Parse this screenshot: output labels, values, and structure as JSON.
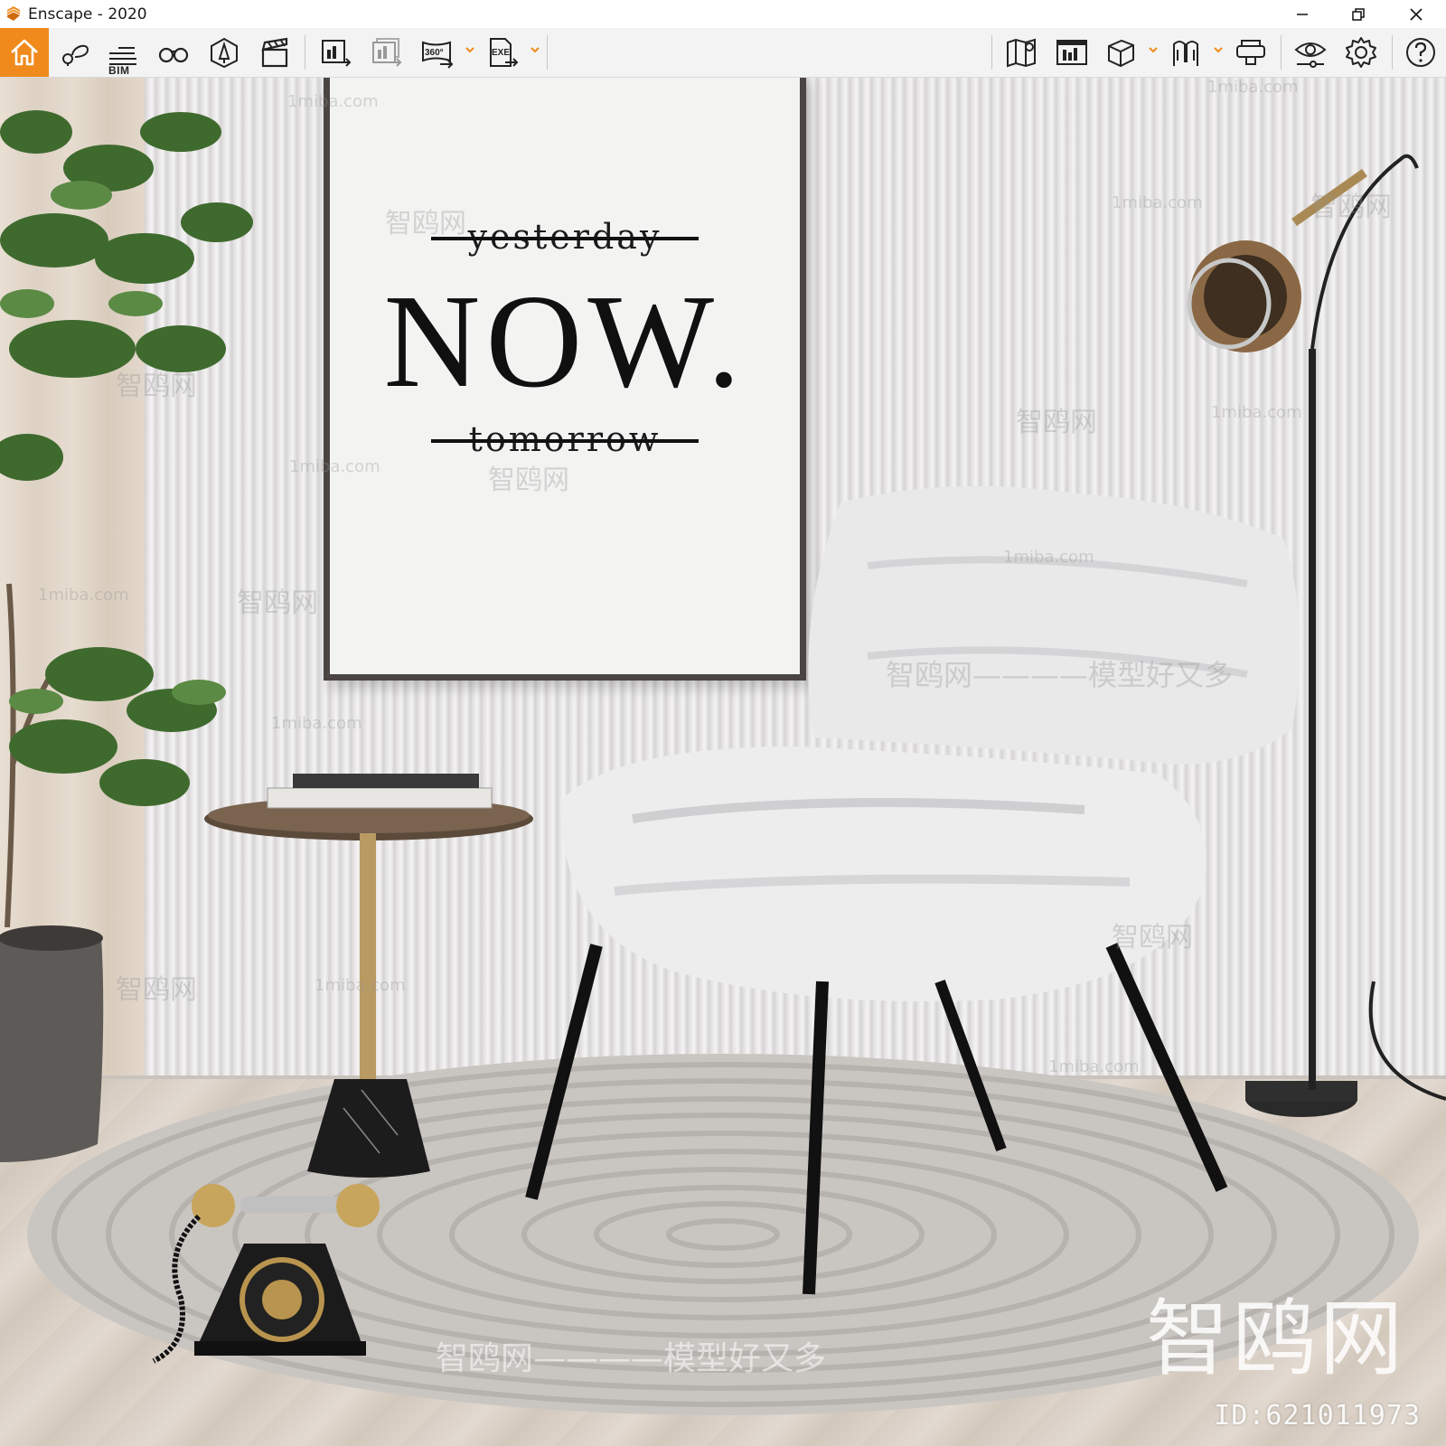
{
  "window": {
    "title": "Enscape - 2020"
  },
  "toolbar": {
    "left": [
      {
        "icon": "home-icon"
      },
      {
        "icon": "views-icon"
      },
      {
        "icon": "bim-list-icon",
        "label": "BIM"
      },
      {
        "icon": "binoculars-icon"
      },
      {
        "icon": "assets-icon"
      },
      {
        "icon": "clapperboard-icon"
      },
      {
        "icon": "render-image-icon"
      },
      {
        "icon": "batch-render-icon"
      },
      {
        "icon": "panorama-360-icon",
        "label": "360°"
      },
      {
        "icon": "export-exe-icon",
        "label": "EXE"
      }
    ],
    "right": [
      {
        "icon": "map-icon"
      },
      {
        "icon": "screenshot-manager-icon"
      },
      {
        "icon": "cube-icon"
      },
      {
        "icon": "vr-headset-icon"
      },
      {
        "icon": "collaborate-icon"
      },
      {
        "icon": "visual-settings-icon"
      },
      {
        "icon": "settings-gear-icon"
      },
      {
        "icon": "help-icon"
      }
    ]
  },
  "poster": {
    "line1": "yesterday",
    "main": "NOW.",
    "line3": "tomorrow"
  },
  "watermarks": {
    "site": "1miba.com",
    "brand": "智鸥网",
    "slogan": "智鸥网————模型好又多",
    "id": "ID:621011973"
  },
  "colors": {
    "accent": "#f08a1c"
  }
}
